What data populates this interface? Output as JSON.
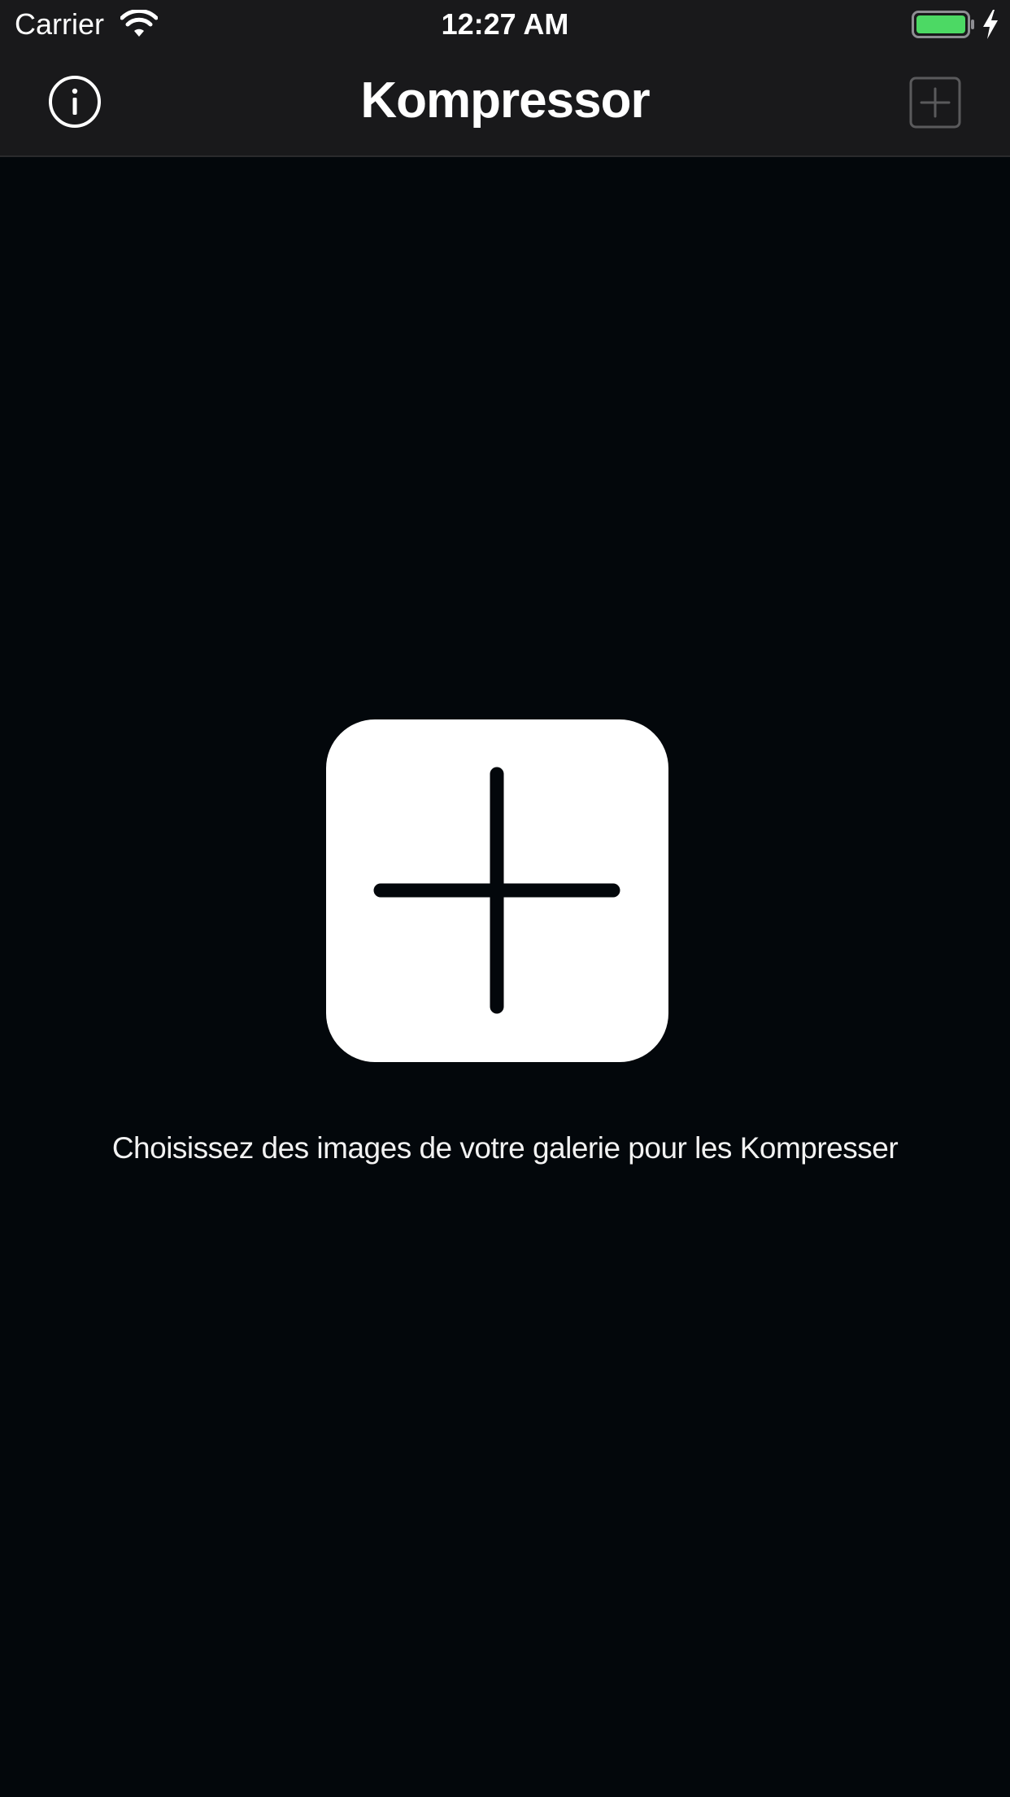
{
  "status_bar": {
    "carrier": "Carrier",
    "time": "12:27 AM",
    "battery_color": "#4cd964",
    "icons": [
      "wifi-icon",
      "battery-icon",
      "charging-icon"
    ]
  },
  "nav_bar": {
    "title": "Kompressor",
    "left_icon": "info-icon",
    "right_icon": "plus-square-icon"
  },
  "main": {
    "add_button_icon": "plus-icon",
    "hint": "Choisissez des images de votre galerie pour les Kompresser"
  },
  "colors": {
    "background": "#03070b",
    "bar_background": "#19191b",
    "disabled_icon": "#5a5a5c"
  }
}
